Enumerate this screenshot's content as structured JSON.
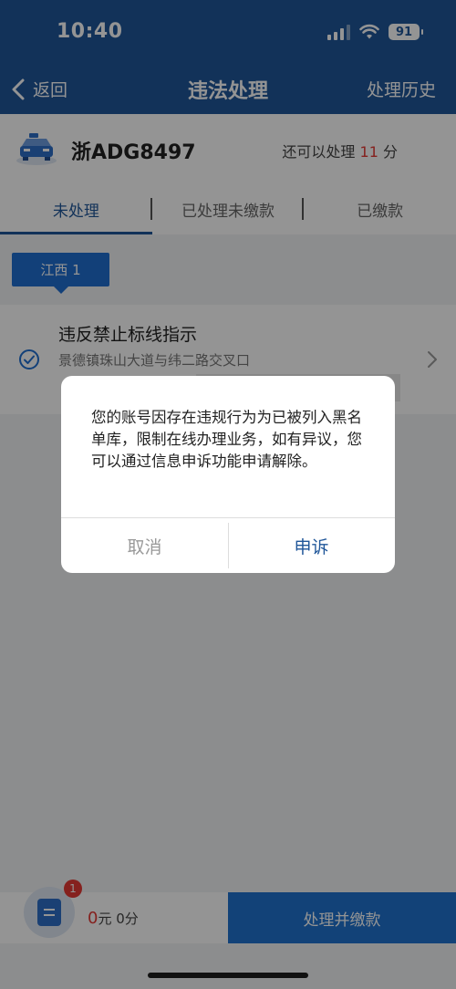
{
  "status_bar": {
    "time": "10:40",
    "battery": "91"
  },
  "nav": {
    "back_label": "返回",
    "title": "违法处理",
    "history_label": "处理历史"
  },
  "vehicle": {
    "plate": "浙ADG8497",
    "remain_prefix": "还可以处理",
    "remain_points": "11",
    "remain_suffix": "分"
  },
  "tabs": [
    {
      "label": "未处理",
      "active": true
    },
    {
      "label": "已处理未缴款",
      "active": false
    },
    {
      "label": "已缴款",
      "active": false
    }
  ],
  "region": {
    "label": "江西 1"
  },
  "violation": {
    "title": "违反禁止标线指示",
    "address": "景德镇珠山大道与纬二路交叉口"
  },
  "bottom": {
    "badge": "1",
    "amount": "0",
    "amount_unit": "元",
    "points": "0分",
    "pay_label": "处理并缴款"
  },
  "dialog": {
    "message": "您的账号因存在违规行为为已被列入黑名单库，限制在线办理业务，如有异议，您可以通过信息申诉功能申请解除。",
    "cancel_label": "取消",
    "appeal_label": "申诉"
  },
  "colors": {
    "primary": "#1f5699",
    "accent_red": "#e53935",
    "button_blue": "#1f72cf"
  }
}
